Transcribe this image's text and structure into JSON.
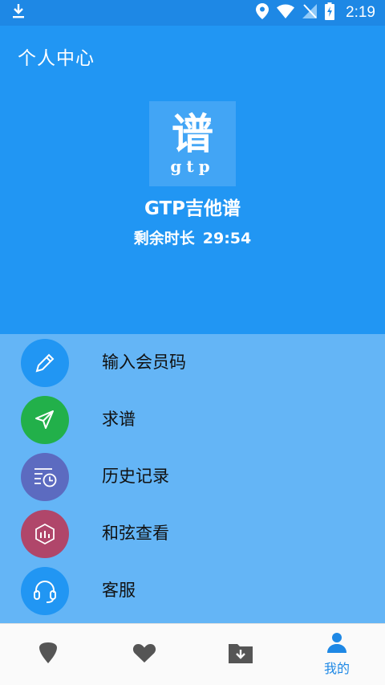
{
  "status_bar": {
    "time": "2:19",
    "icons": [
      "download-icon",
      "location-icon",
      "wifi-icon",
      "no-signal-icon",
      "battery-charging-icon"
    ]
  },
  "header": {
    "title": "个人中心"
  },
  "profile": {
    "logo_char": "谱",
    "logo_sub": "gtp",
    "app_name": "GTP吉他谱",
    "remaining_label": "剩余时长",
    "remaining_value": "29:54"
  },
  "menu": {
    "items": [
      {
        "label": "输入会员码",
        "icon": "pencil-icon",
        "color": "#2196f3"
      },
      {
        "label": "求谱",
        "icon": "send-icon",
        "color": "#22b04a"
      },
      {
        "label": "历史记录",
        "icon": "history-icon",
        "color": "#5c6bc0"
      },
      {
        "label": "和弦查看",
        "icon": "chord-icon",
        "color": "#b0466a"
      },
      {
        "label": "客服",
        "icon": "headset-icon",
        "color": "#2196f3"
      }
    ]
  },
  "bottom_nav": {
    "items": [
      {
        "icon": "guitar-pick-icon",
        "label": ""
      },
      {
        "icon": "heart-icon",
        "label": ""
      },
      {
        "icon": "download-folder-icon",
        "label": ""
      },
      {
        "icon": "user-icon",
        "label": "我的"
      }
    ]
  },
  "colors": {
    "primary": "#2196f3",
    "status_bar": "#1e88e5",
    "menu_bg": "#64b5f6",
    "nav_inactive": "#555555"
  }
}
